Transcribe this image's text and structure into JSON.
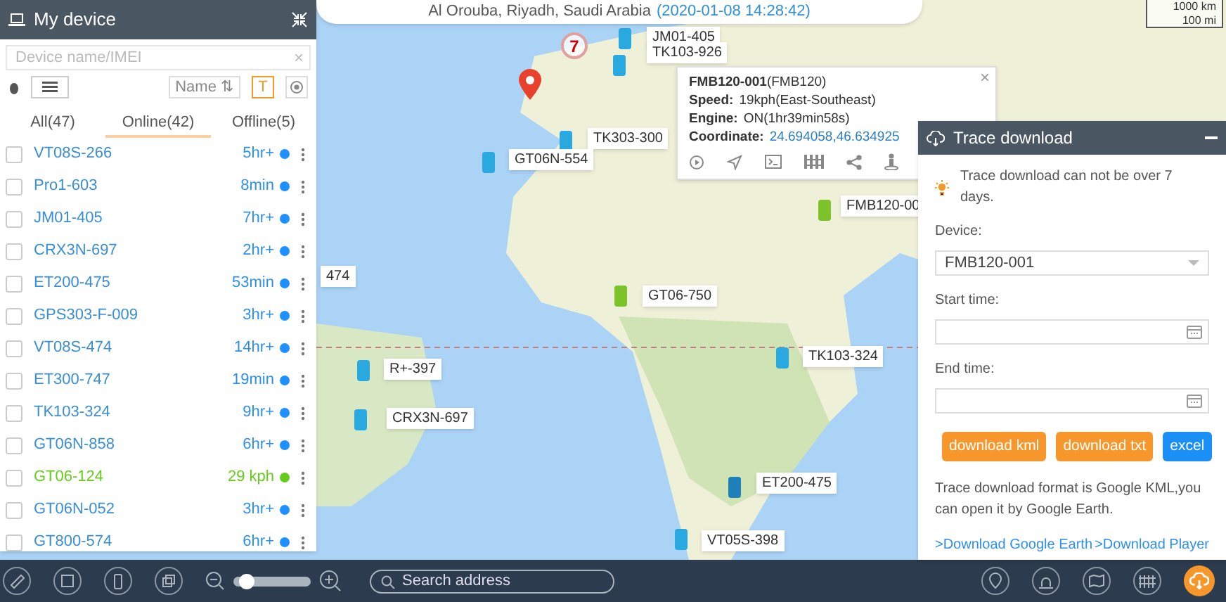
{
  "address_bar": {
    "address": "Al Orouba, Riyadh, Saudi Arabia",
    "time": "(2020-01-08 14:28:42)"
  },
  "scale": [
    "1000 km",
    "100 mi"
  ],
  "device_panel": {
    "title": "My device",
    "search": {
      "placeholder": "Device name/IMEI",
      "clear": "×"
    },
    "sort_button": "Name ⇅",
    "label_toggle": {
      "text": "T",
      "on": true
    },
    "tabs": [
      {
        "label": "All(47)",
        "selected": false
      },
      {
        "label": "Online(42)",
        "selected": true
      },
      {
        "label": "Offline(5)",
        "selected": false
      }
    ],
    "devices": [
      {
        "name": "VT08S-266",
        "status": "5hr+",
        "color": "#1e90ff",
        "checked": false
      },
      {
        "name": "Pro1-603",
        "status": "8min",
        "color": "#1e90ff",
        "checked": false
      },
      {
        "name": "JM01-405",
        "status": "7hr+",
        "color": "#1e90ff",
        "checked": false
      },
      {
        "name": "CRX3N-697",
        "status": "2hr+",
        "color": "#1e90ff",
        "checked": false
      },
      {
        "name": "ET200-475",
        "status": "53min",
        "color": "#1e90ff",
        "checked": false
      },
      {
        "name": "GPS303-F-009",
        "status": "3hr+",
        "color": "#1e90ff",
        "checked": false
      },
      {
        "name": "VT08S-474",
        "status": "14hr+",
        "color": "#1e90ff",
        "checked": false
      },
      {
        "name": "ET300-747",
        "status": "19min",
        "color": "#1e90ff",
        "checked": false
      },
      {
        "name": "TK103-324",
        "status": "9hr+",
        "color": "#1e90ff",
        "checked": false
      },
      {
        "name": "GT06N-858",
        "status": "6hr+",
        "color": "#1e90ff",
        "checked": false
      },
      {
        "name": "GT06-124",
        "status": "29 kph",
        "color": "#66cc1a",
        "checked": false
      },
      {
        "name": "GT06N-052",
        "status": "3hr+",
        "color": "#1e90ff",
        "checked": false
      },
      {
        "name": "GT800-574",
        "status": "6hr+",
        "color": "#1e90ff",
        "checked": false
      }
    ]
  },
  "map": {
    "cluster": "7",
    "markers": [
      {
        "label": "JM01-405",
        "color": "#29a9e0"
      },
      {
        "label": "TK103-926",
        "color": "#29a9e0"
      },
      {
        "label": "TK303-300",
        "color": "#29a9e0"
      },
      {
        "label": "GT06N-554",
        "color": "#29a9e0"
      },
      {
        "label": "GT06-750",
        "color": "#7cc22a"
      },
      {
        "label": "R+-397",
        "color": "#29a9e0"
      },
      {
        "label": "CRX3N-697",
        "color": "#29a9e0"
      },
      {
        "label": "TK103-324",
        "color": "#29a9e0"
      },
      {
        "label": "ET200-475",
        "color": "#1f7fb8"
      },
      {
        "label": "VT05S-398",
        "color": "#29a9e0"
      },
      {
        "label": "FMB120-00",
        "color": "#7cc22a"
      },
      {
        "label": "474"
      }
    ]
  },
  "info_popup": {
    "close": "×",
    "title": "**FMB120-001**(FMB120)",
    "lines": [
      {
        "label": "Speed:",
        "value": "19kph(East-Southeast)",
        "kind": "text"
      },
      {
        "label": "Engine:",
        "value": "ON(1hr39min58s)",
        "kind": "text"
      },
      {
        "label": "Coordinate:",
        "value": "24.694058,46.634925",
        "kind": "link"
      }
    ]
  },
  "trace_panel": {
    "title": "Trace download",
    "tip": "Trace download can not be over 7 days.",
    "device_label": "Device:",
    "device_value": "FMB120-001",
    "start_label": "Start time:",
    "end_label": "End time:",
    "buttons": [
      {
        "label": "download kml",
        "kind": "orange"
      },
      {
        "label": "download txt",
        "kind": "orange"
      },
      {
        "label": "excel",
        "kind": "blue"
      }
    ],
    "note": "Trace download format is Google KML,you can open it by Google Earth.",
    "links": [
      ">Download Google Earth",
      ">Download Player"
    ]
  },
  "toolbar": {
    "zoom": {
      "level": 0.1
    },
    "search": {
      "placeholder": "Search address"
    }
  }
}
